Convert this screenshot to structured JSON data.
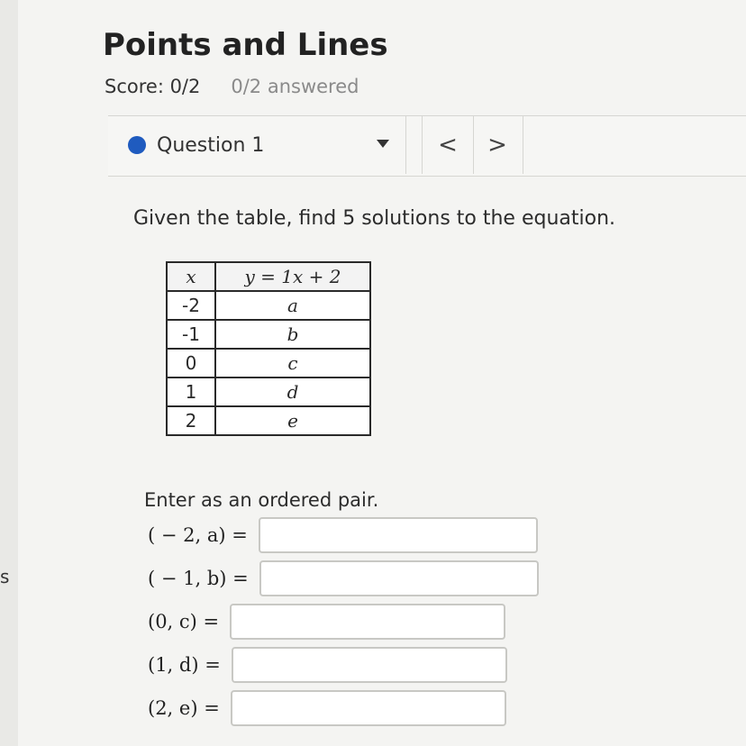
{
  "page": {
    "title": "Points and Lines",
    "score": "Score: 0/2",
    "answered": "0/2 answered",
    "edge_letter": "s"
  },
  "question_nav": {
    "label": "Question 1",
    "prev": "<",
    "next": ">",
    "icons": {
      "status": "dot-icon",
      "dropdown": "caret-down-icon"
    },
    "colors": {
      "status_dot": "#1f5bbf"
    }
  },
  "question": {
    "prompt": "Given the table, find 5 solutions to the equation.",
    "table": {
      "headers": [
        "x",
        "y = 1x + 2"
      ],
      "rows": [
        [
          "-2",
          "a"
        ],
        [
          "-1",
          "b"
        ],
        [
          "0",
          "c"
        ],
        [
          "1",
          "d"
        ],
        [
          "2",
          "e"
        ]
      ]
    },
    "instruction": "Enter as an ordered pair.",
    "answers": [
      {
        "label": "( − 2, a) =",
        "value": ""
      },
      {
        "label": "( − 1, b) =",
        "value": ""
      },
      {
        "label": "(0, c) =",
        "value": ""
      },
      {
        "label": "(1, d) =",
        "value": ""
      },
      {
        "label": "(2, e) =",
        "value": ""
      }
    ]
  }
}
